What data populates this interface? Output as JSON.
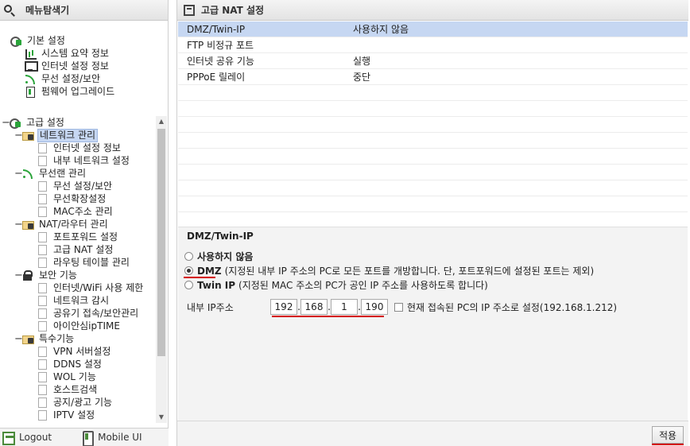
{
  "left_panel": {
    "title": "메뉴탐색기",
    "basic": {
      "label": "기본 설정",
      "items": [
        "시스템 요약 정보",
        "인터넷 설정 정보",
        "무선 설정/보안",
        "펌웨어 업그레이드"
      ]
    },
    "advanced": {
      "label": "고급 설정",
      "groups": [
        {
          "label": "네트워크 관리",
          "items": [
            "인터넷 설정 정보",
            "내부 네트워크 설정"
          ]
        },
        {
          "label": "무선랜 관리",
          "items": [
            "무선 설정/보안",
            "무선확장설정",
            "MAC주소 관리"
          ]
        },
        {
          "label": "NAT/라우터 관리",
          "items": [
            "포트포워드 설정",
            "고급 NAT 설정",
            "라우팅 테이블 관리"
          ]
        },
        {
          "label": "보안 기능",
          "items": [
            "인터넷/WiFi 사용 제한",
            "네트워크 감시",
            "공유기 접속/보안관리",
            "아이안심ipTIME"
          ]
        },
        {
          "label": "특수기능",
          "items": [
            "VPN 서버설정",
            "DDNS 설정",
            "WOL 기능",
            "호스트검색",
            "공지/광고 기능",
            "IPTV 설정"
          ]
        }
      ]
    },
    "footer": {
      "logout": "Logout",
      "mobile": "Mobile UI"
    }
  },
  "right_panel": {
    "title": "고급 NAT 설정",
    "summary": [
      {
        "name": "DMZ/Twin-IP",
        "value": "사용하지 않음"
      },
      {
        "name": "FTP 비정규 포트",
        "value": ""
      },
      {
        "name": "인터넷 공유 기능",
        "value": "실행"
      },
      {
        "name": "PPPoE 릴레이",
        "value": "중단"
      }
    ],
    "section": {
      "title": "DMZ/Twin-IP",
      "opt_none": "사용하지 않음",
      "opt_dmz": "DMZ",
      "opt_dmz_desc": "(지정된 내부 IP 주소의 PC로 모든 포트를 개방합니다. 단, 포트포워드에 설정된 포트는 제외)",
      "opt_twin": "Twin IP",
      "opt_twin_desc": "(지정된 MAC 주소의 PC가 공인 IP 주소를 사용하도록 합니다)",
      "ip_label": "내부 IP주소",
      "ip": [
        "192",
        "168",
        "1",
        "190"
      ],
      "current_pc": "현재 접속된 PC의 IP 주소로 설정(192.168.1.212)"
    },
    "apply": "적용"
  },
  "colors": {
    "selection": "#c6d7f2",
    "annotation_red": "#d40000"
  }
}
